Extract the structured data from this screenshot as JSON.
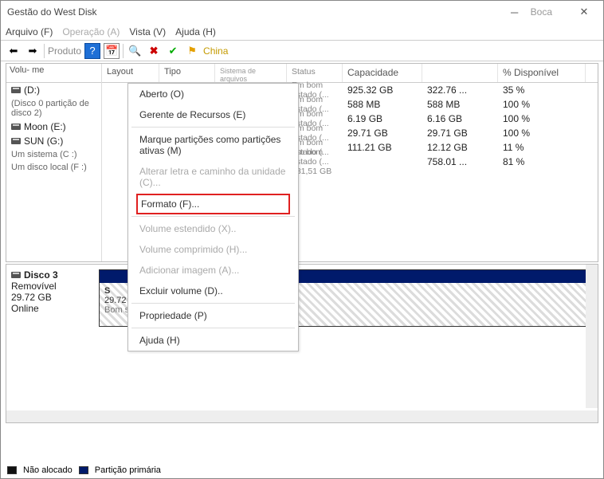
{
  "title": "Gestão do West Disk",
  "window_label": "Boca",
  "menubar": [
    "Arquivo (F)",
    "Operação (A)",
    "Vista (V)",
    "Ajuda (H)"
  ],
  "menubar_dim": [
    false,
    true,
    false,
    false
  ],
  "toolbar_text1": "Produto",
  "toolbar_text2": "China",
  "headers": {
    "volume": "Volu-\nme",
    "layout": "Layout",
    "tipo": "Tipo",
    "fs": "Sistema de arquivos",
    "status": "Status",
    "cap": "Capacidade",
    "free": "",
    "pct": "% Disponível"
  },
  "volumes": [
    {
      "name": "(D:)",
      "icon": true
    },
    {
      "name": "(Disco 0 partição de disco 2)",
      "icon": false,
      "sub": true
    },
    {
      "name": "Moon (E:)",
      "icon": true
    },
    {
      "name": "SUN (G:)",
      "icon": true
    },
    {
      "name": "Um sistema (C :)",
      "icon": false,
      "sub": true
    },
    {
      "name": "Um disco local (F :)",
      "icon": false,
      "sub": true
    }
  ],
  "rows": [
    {
      "status": "Em bom estado (...",
      "cap": "925.32 GB",
      "free": "322.76 ...",
      "pct": "35 %"
    },
    {
      "status": "Em bom estado (...",
      "cap": "588 MB",
      "free": "588 MB",
      "pct": "100 %"
    },
    {
      "status": "Em bom estado (...",
      "cap": "6.19 GB",
      "free": "6.16 GB",
      "pct": "100 %"
    },
    {
      "status": "Em bom estado (...",
      "cap": "29.71 GB",
      "free": "29.71 GB",
      "pct": "100 %"
    },
    {
      "status": "Em bom estado (...",
      "cap": "111.21 GB",
      "free": "12.12 GB",
      "pct": "11 %"
    },
    {
      "status": "Em bom estado (... 931,51 GB",
      "cap": "",
      "free": "758.01 ...",
      "pct": "81 %"
    }
  ],
  "context_menu": [
    {
      "label": "Aberto (O)",
      "dim": false
    },
    {
      "label": "Gerente de Recursos (E)",
      "dim": false
    },
    {
      "sep": true
    },
    {
      "label": "Marque partições como partições ativas (M)",
      "dim": false
    },
    {
      "label": "Alterar letra e caminho da unidade (C)...",
      "dim": true
    },
    {
      "label": "Formato (F)...",
      "dim": false,
      "hl": true
    },
    {
      "sep": true
    },
    {
      "label": "Volume estendido (X)..",
      "dim": true
    },
    {
      "label": "Volume comprimido (H)...",
      "dim": true
    },
    {
      "label": "Adicionar imagem (A)...",
      "dim": true
    },
    {
      "label": "Excluir volume (D)..",
      "dim": false
    },
    {
      "sep": true
    },
    {
      "label": "Propriedade (P)",
      "dim": false
    },
    {
      "sep": true
    },
    {
      "label": "Ajuda (H)",
      "dim": false
    }
  ],
  "graph": {
    "disk_title": "Disco 3",
    "disk_type": "Removível",
    "disk_size": "29.72 GB",
    "disk_state": "Online",
    "part_name": "S",
    "part_size": "29.72 GB FAT32",
    "part_status": "Bom status (partição primária)"
  },
  "legend": {
    "a": "Não alocado",
    "b": "Partição primária"
  }
}
